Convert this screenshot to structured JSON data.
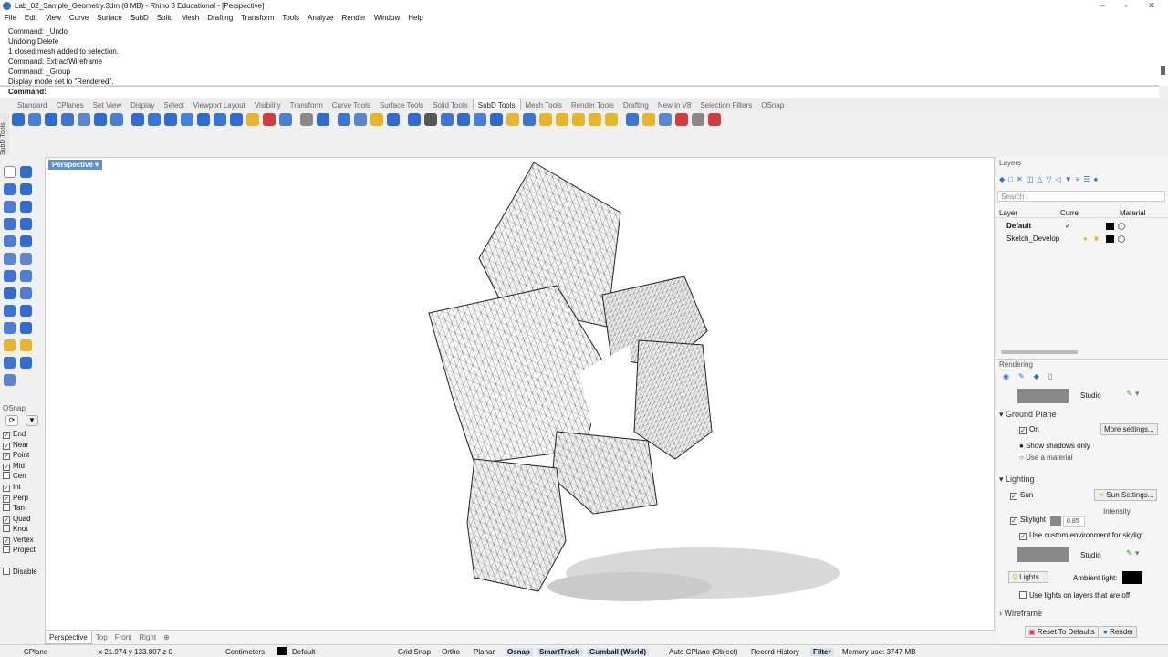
{
  "title": "Lab_02_Sample_Geometry.3dm (8 MB) - Rhino 8 Educational - [Perspective]",
  "menu": [
    "File",
    "Edit",
    "View",
    "Curve",
    "Surface",
    "SubD",
    "Solid",
    "Mesh",
    "Drafting",
    "Transform",
    "Tools",
    "Analyze",
    "Render",
    "Window",
    "Help"
  ],
  "history": [
    "Command: _Undo",
    "Undoing Delete",
    "1 closed mesh added to selection.",
    "Command: ExtractWireframe",
    "Command: _Group",
    "Display mode set to \"Rendered\"."
  ],
  "prompt": "Command:",
  "tabs": [
    "Standard",
    "CPlanes",
    "Set View",
    "Display",
    "Select",
    "Viewport Layout",
    "Visibility",
    "Transform",
    "Curve Tools",
    "Surface Tools",
    "Solid Tools",
    "SubD Tools",
    "Mesh Tools",
    "Render Tools",
    "Drafting",
    "New in V8",
    "Selection Filters",
    "OSnap"
  ],
  "active_tab": "SubD Tools",
  "subd_label": "SubD Tools",
  "viewport_label": "Perspective",
  "viewport_tabs": [
    "Perspective",
    "Top",
    "Front",
    "Right"
  ],
  "osnap": {
    "title": "OSnap",
    "items": [
      {
        "label": "End",
        "checked": true
      },
      {
        "label": "Near",
        "checked": true
      },
      {
        "label": "Point",
        "checked": true
      },
      {
        "label": "Mid",
        "checked": true
      },
      {
        "label": "Cen",
        "checked": false
      },
      {
        "label": "Int",
        "checked": true
      },
      {
        "label": "Perp",
        "checked": true
      },
      {
        "label": "Tan",
        "checked": false
      },
      {
        "label": "Quad",
        "checked": true
      },
      {
        "label": "Knot",
        "checked": false
      },
      {
        "label": "Vertex",
        "checked": true
      },
      {
        "label": "Project",
        "checked": false
      }
    ],
    "disable": "Disable"
  },
  "layers": {
    "title": "Layers",
    "search_placeholder": "Search",
    "col_layer": "Layer",
    "col_current": "Curre",
    "col_material": "Material",
    "rows": [
      {
        "name": "Default",
        "current": "✓",
        "bold": true
      },
      {
        "name": "Sketch_Develop",
        "current": "",
        "bold": false
      }
    ]
  },
  "rendering": {
    "title": "Rendering",
    "environment": "Studio",
    "ground_plane": "Ground Plane",
    "on": "On",
    "more_settings": "More settings...",
    "show_shadows": "Show shadows only",
    "use_material": "Use a material",
    "lighting": "Lighting",
    "sun": "Sun",
    "sun_settings": "Sun Settings...",
    "intensity": "Intensity",
    "skylight": "Skylight",
    "skylight_value": "0.85",
    "use_custom_env": "Use custom environment for skyligt",
    "env2": "Studio",
    "lights": "Lights...",
    "ambient": "Ambient light:",
    "use_lights_layers": "Use lights on layers that are off",
    "wireframe": "Wireframe",
    "reset": "Reset To Defaults",
    "render": "Render"
  },
  "status": {
    "cplane": "CPlane",
    "coords": "x 21.974  y 133.807  z 0",
    "units": "Centimeters",
    "layer": "Default",
    "grid_snap": "Grid Snap",
    "ortho": "Ortho",
    "planar": "Planar",
    "osnap": "Osnap",
    "smarttrack": "SmartTrack",
    "gumball": "Gumball (World)",
    "autocplane": "Auto CPlane (Object)",
    "record_history": "Record History",
    "filter": "Filter",
    "memory": "Memory use: 3747 MB"
  },
  "colors": {
    "accent": "#5b8fd9",
    "toolbar_blue": "#2f6bd0",
    "toolbar_yellow": "#e8b42a",
    "toolbar_red": "#d23c3c"
  }
}
